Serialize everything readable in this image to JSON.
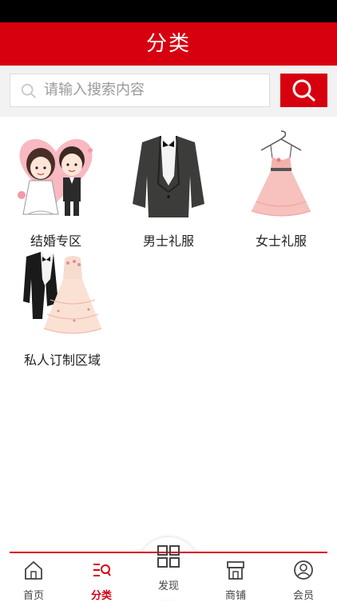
{
  "header": {
    "title": "分类"
  },
  "search": {
    "placeholder": "请输入搜索内容"
  },
  "categories": [
    {
      "label": "结婚专区",
      "image": "wedding-couple-illustration"
    },
    {
      "label": "男士礼服",
      "image": "mens-tuxedo-illustration"
    },
    {
      "label": "女士礼服",
      "image": "womens-dress-illustration"
    },
    {
      "label": "私人订制区域",
      "image": "custom-wedding-outfits-illustration"
    }
  ],
  "tabbar": {
    "items": [
      {
        "label": "首页",
        "icon": "home-icon"
      },
      {
        "label": "分类",
        "icon": "category-icon",
        "active": true
      },
      {
        "label": "发现",
        "icon": "discover-grid-icon"
      },
      {
        "label": "商铺",
        "icon": "shop-icon"
      },
      {
        "label": "会员",
        "icon": "member-icon"
      }
    ]
  },
  "colors": {
    "brand": "#d7000f",
    "background": "#ffffff",
    "search_bg": "#f2f2f2"
  }
}
